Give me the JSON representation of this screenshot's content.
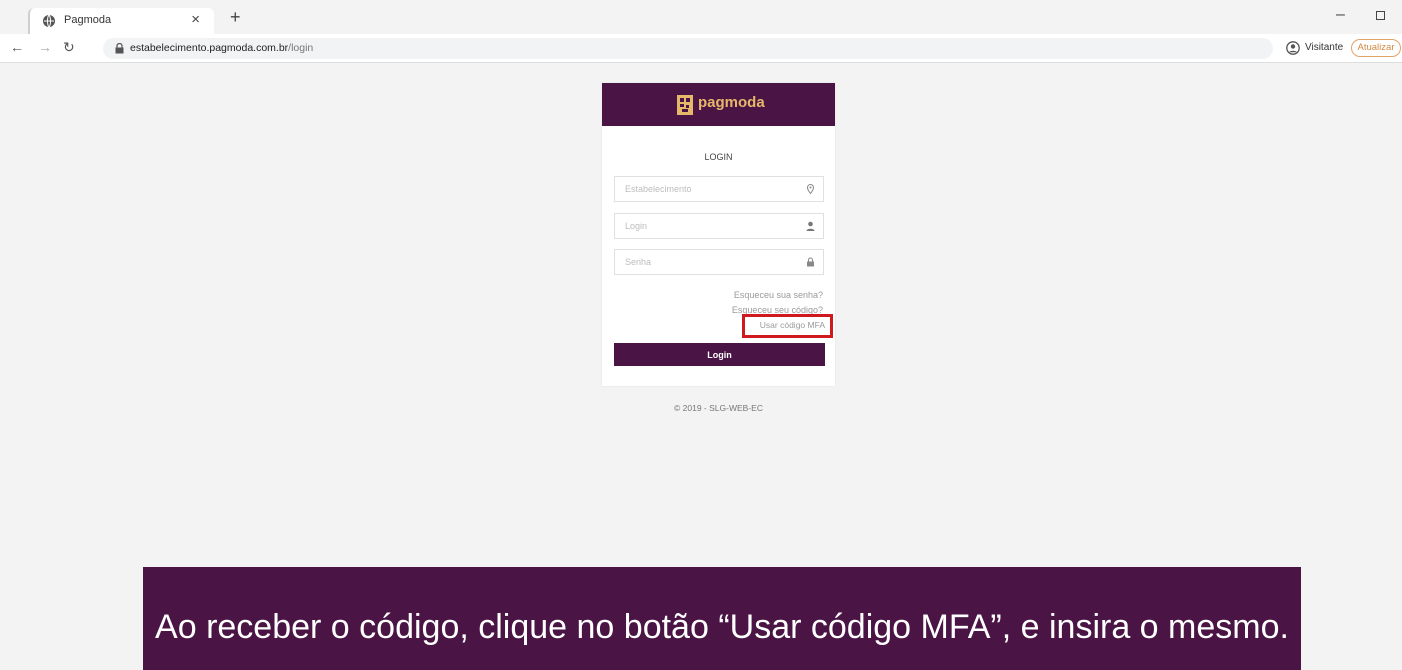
{
  "browser": {
    "tab_title": "Pagmoda",
    "tab_close": "×",
    "new_tab": "+",
    "url_host": "estabelecimento.pagmoda.com.br",
    "url_path": "/login",
    "profile_label": "Visitante",
    "update_label": "Atualizar",
    "minimize": "–"
  },
  "login": {
    "brand": "pagmoda",
    "heading": "LOGIN",
    "establishment_placeholder": "Estabelecimento",
    "login_placeholder": "Login",
    "password_placeholder": "Senha",
    "forgot_password": "Esqueceu sua senha?",
    "forgot_code": "Esqueceu seu código?",
    "use_mfa": "Usar código MFA",
    "submit": "Login",
    "copyright": "© 2019 - SLG-WEB-EC"
  },
  "caption": {
    "text": "Ao receber o código, clique no botão “Usar código MFA”, e insira o mesmo."
  },
  "colors": {
    "brand_purple": "#4a1545",
    "brand_gold": "#e7b86a",
    "highlight_red": "#d0191e",
    "update_orange": "#e3a268"
  }
}
